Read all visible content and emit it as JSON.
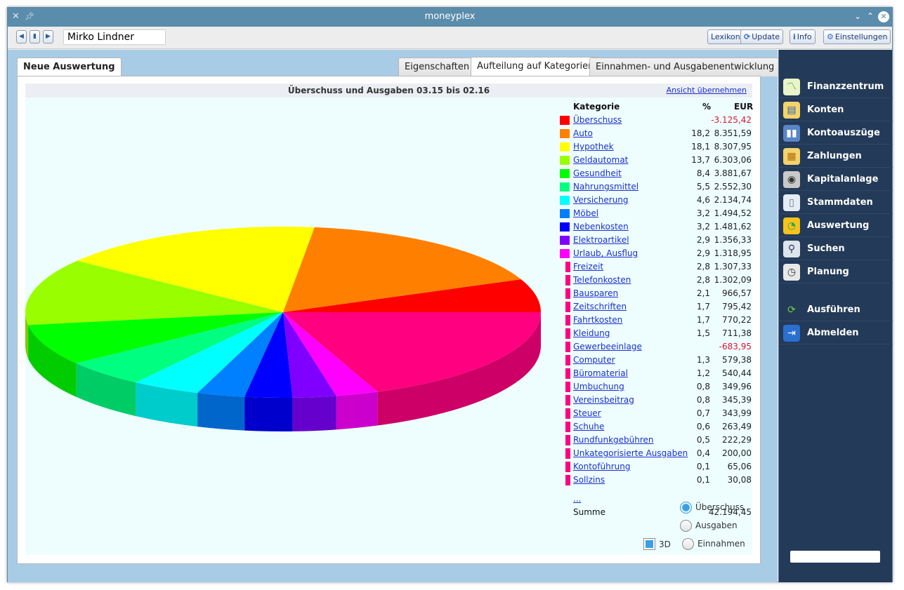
{
  "window": {
    "title": "moneyplex"
  },
  "toolbar": {
    "user": "Mirko Lindner",
    "lexikon": "Lexikon",
    "update": "Update",
    "info": "Info",
    "einstellungen": "Einstellungen"
  },
  "tabs": {
    "left": "Neue Auswertung",
    "eigenschaften": "Eigenschaften",
    "aufteilung": "Aufteilung auf Kategorien",
    "entwicklung": "Einnahmen- und Ausgabenentwicklung"
  },
  "chart_header": {
    "title": "Überschuss und Ausgaben  03.15 bis 02.16",
    "link": "Ansicht übernehmen"
  },
  "legend": {
    "col_category": "Kategorie",
    "col_pct": "%",
    "col_eur": "EUR",
    "more": "...",
    "sum_label": "Summe",
    "sum_value": "42.194,45"
  },
  "options": {
    "ueberschuss": "Überschuss",
    "ausgaben": "Ausgaben",
    "einnahmen": "Einnahmen",
    "threed": "3D",
    "selected": "ueberschuss",
    "threed_checked": true
  },
  "sidebar": {
    "items": [
      {
        "label": "Finanzzentrum",
        "icon": "chart-icon"
      },
      {
        "label": "Konten",
        "icon": "wallet-icon"
      },
      {
        "label": "Kontoauszüge",
        "icon": "binder-icon"
      },
      {
        "label": "Zahlungen",
        "icon": "form-icon"
      },
      {
        "label": "Kapitalanlage",
        "icon": "safe-icon"
      },
      {
        "label": "Stammdaten",
        "icon": "book-icon"
      },
      {
        "label": "Auswertung",
        "icon": "pie-icon"
      },
      {
        "label": "Suchen",
        "icon": "magnifier-icon"
      },
      {
        "label": "Planung",
        "icon": "clock-icon"
      },
      {
        "label": "Ausführen",
        "icon": "refresh-icon"
      },
      {
        "label": "Abmelden",
        "icon": "exit-icon"
      }
    ]
  },
  "chart_data": {
    "type": "pie",
    "threed": true,
    "slices": [
      {
        "name": "Überschuss",
        "pct": null,
        "eur": "-3.125,42",
        "color": "#ff0000",
        "negative": true
      },
      {
        "name": "Auto",
        "pct": "18,2",
        "eur": "8.351,59",
        "color": "#ff8000"
      },
      {
        "name": "Hypothek",
        "pct": "18,1",
        "eur": "8.307,95",
        "color": "#ffff00"
      },
      {
        "name": "Geldautomat",
        "pct": "13,7",
        "eur": "6.303,06",
        "color": "#99ff00"
      },
      {
        "name": "Gesundheit",
        "pct": "8,4",
        "eur": "3.881,67",
        "color": "#00ff00"
      },
      {
        "name": "Nahrungsmittel",
        "pct": "5,5",
        "eur": "2.552,30",
        "color": "#00ff80"
      },
      {
        "name": "Versicherung",
        "pct": "4,6",
        "eur": "2.134,74",
        "color": "#00ffff"
      },
      {
        "name": "Möbel",
        "pct": "3,2",
        "eur": "1.494,52",
        "color": "#0080ff"
      },
      {
        "name": "Nebenkosten",
        "pct": "3,2",
        "eur": "1.481,62",
        "color": "#0000ff"
      },
      {
        "name": "Elektroartikel",
        "pct": "2,9",
        "eur": "1.356,33",
        "color": "#8000ff"
      },
      {
        "name": "Urlaub, Ausflug",
        "pct": "2,9",
        "eur": "1.318,95",
        "color": "#ff00ff"
      },
      {
        "name": "Freizeit",
        "pct": "2,8",
        "eur": "1.307,33",
        "color": "#ff0080",
        "grouped": true
      },
      {
        "name": "Telefonkosten",
        "pct": "2,8",
        "eur": "1.302,09",
        "color": "#ff0080",
        "grouped": true
      },
      {
        "name": "Bausparen",
        "pct": "2,1",
        "eur": "966,57",
        "color": "#ff0080",
        "grouped": true
      },
      {
        "name": "Zeitschriften",
        "pct": "1,7",
        "eur": "795,42",
        "color": "#ff0080",
        "grouped": true
      },
      {
        "name": "Fahrtkosten",
        "pct": "1,7",
        "eur": "770,22",
        "color": "#ff0080",
        "grouped": true
      },
      {
        "name": "Kleidung",
        "pct": "1,5",
        "eur": "711,38",
        "color": "#ff0080",
        "grouped": true
      },
      {
        "name": "Gewerbeeinlage",
        "pct": null,
        "eur": "-683,95",
        "color": "#ff0080",
        "grouped": true,
        "negative": true
      },
      {
        "name": "Computer",
        "pct": "1,3",
        "eur": "579,38",
        "color": "#ff0080",
        "grouped": true
      },
      {
        "name": "Büromaterial",
        "pct": "1,2",
        "eur": "540,44",
        "color": "#ff0080",
        "grouped": true
      },
      {
        "name": "Umbuchung",
        "pct": "0,8",
        "eur": "349,96",
        "color": "#ff0080",
        "grouped": true
      },
      {
        "name": "Vereinsbeitrag",
        "pct": "0,8",
        "eur": "345,39",
        "color": "#ff0080",
        "grouped": true
      },
      {
        "name": "Steuer",
        "pct": "0,7",
        "eur": "343,99",
        "color": "#ff0080",
        "grouped": true
      },
      {
        "name": "Schuhe",
        "pct": "0,6",
        "eur": "263,49",
        "color": "#ff0080",
        "grouped": true
      },
      {
        "name": "Rundfunkgebühren",
        "pct": "0,5",
        "eur": "222,29",
        "color": "#ff0080",
        "grouped": true
      },
      {
        "name": "Unkategorisierte Ausgaben",
        "pct": "0,4",
        "eur": "200,00",
        "color": "#ff0080",
        "grouped": true
      },
      {
        "name": "Kontoführung",
        "pct": "0,1",
        "eur": "65,06",
        "color": "#ff0080",
        "grouped": true
      },
      {
        "name": "Sollzins",
        "pct": "0,1",
        "eur": "30,08",
        "color": "#ff0080",
        "grouped": true
      }
    ]
  }
}
